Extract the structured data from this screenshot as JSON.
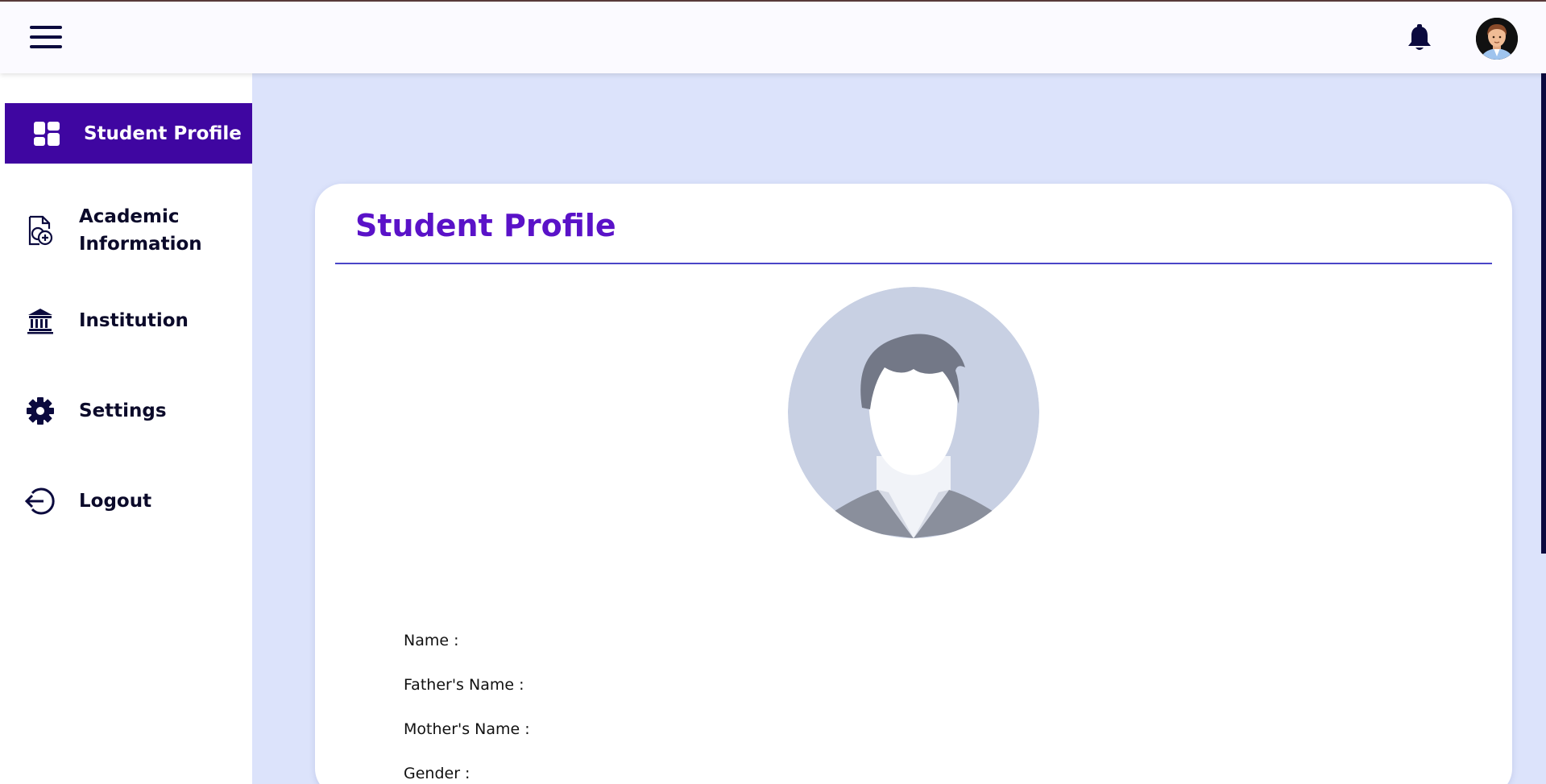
{
  "sidebar": {
    "items": [
      {
        "label": "Student Profile",
        "icon": "dashboard-icon",
        "active": true
      },
      {
        "label": "Academic Information",
        "icon": "document-add-icon"
      },
      {
        "label": "Institution",
        "icon": "institution-icon"
      },
      {
        "label": "Settings",
        "icon": "gear-icon"
      },
      {
        "label": "Logout",
        "icon": "logout-icon"
      }
    ]
  },
  "header": {
    "menu_icon": "hamburger-icon",
    "notification_icon": "bell-icon",
    "avatar_icon": "user-avatar-icon"
  },
  "main": {
    "title": "Student Profile",
    "fields": [
      {
        "label": "Name :"
      },
      {
        "label": "Father's Name :"
      },
      {
        "label": "Mother's Name :"
      },
      {
        "label": "Gender :"
      }
    ]
  },
  "colors": {
    "accent": "#3f06a1",
    "title": "#5a12c8",
    "background": "#dce3fb",
    "navy": "#0b0a3e"
  }
}
